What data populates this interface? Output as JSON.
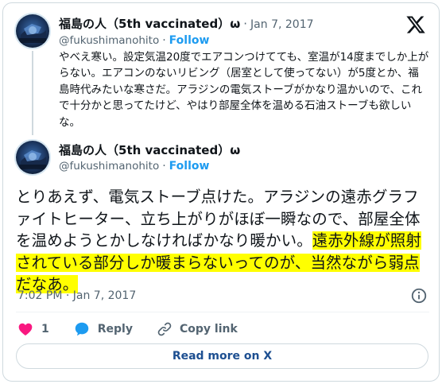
{
  "parent_tweet": {
    "display_name": "福島の人（5th vaccinated）ω",
    "separator": "·",
    "date": "Jan 7, 2017",
    "handle": "@fukushimanohito",
    "follow_separator": "·",
    "follow_label": "Follow",
    "text": "やべえ寒い。設定気温20度でエアコンつけてても、室温が14度までしか上がらない。エアコンのないリビング（居室として使ってない）が5度とか、福島時代みたいな寒さだ。アラジンの電気ストーブがかなり温かいので、これで十分かと思ってたけど、やはり部屋全体を温める石油ストーブも欲しいな。"
  },
  "main_tweet": {
    "display_name": "福島の人（5th vaccinated）ω",
    "handle": "@fukushimanohito",
    "follow_separator": "·",
    "follow_label": "Follow",
    "text_plain": "とりあえず、電気ストーブ点けた。アラジンの遠赤グラファイトヒーター、立ち上がりがほぼ一瞬なので、部屋全体を温めようとかしなければかなり暖かい。",
    "text_highlighted": "遠赤外線が照射されている部分しか暖まらないってのが、当然ながら弱点だなあ。",
    "timestamp": "7:02 PM · Jan 7, 2017"
  },
  "actions": {
    "like_count": "1",
    "reply_label": "Reply",
    "copy_link_label": "Copy link"
  },
  "read_more_label": "Read more on X",
  "icons": {
    "brand": "x-logo-icon",
    "info": "info-icon",
    "like": "heart-icon",
    "reply": "speech-bubble-icon",
    "copy_link": "link-icon"
  },
  "colors": {
    "accent": "#1d9bf0",
    "like": "#f91880",
    "highlight": "#ffff00",
    "secondary_text": "#536471",
    "border": "#cfd9de",
    "read_more_text": "#1d4f91"
  }
}
